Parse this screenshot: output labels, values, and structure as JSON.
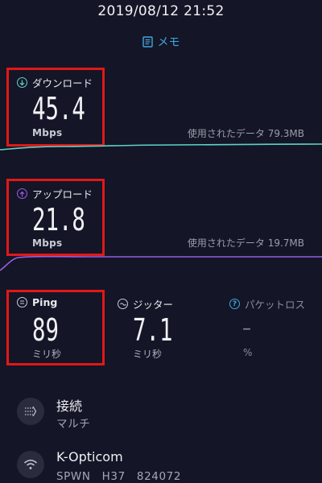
{
  "status": {
    "datetime": "2019/08/12 21:52"
  },
  "memo": {
    "label": "メモ"
  },
  "download": {
    "label": "ダウンロード",
    "value": "45.4",
    "unit": "Mbps",
    "used": "使用されたデータ 79.3MB"
  },
  "upload": {
    "label": "アップロード",
    "value": "21.8",
    "unit": "Mbps",
    "used": "使用されたデータ 19.7MB"
  },
  "ping": {
    "label": "Ping",
    "value": "89",
    "unit": "ミリ秒"
  },
  "jitter": {
    "label": "ジッター",
    "value": "7.1",
    "unit": "ミリ秒"
  },
  "packet_loss": {
    "label": "パケットロス",
    "value": "–",
    "unit": "%"
  },
  "connection": {
    "title": "接続",
    "value": "マルチ"
  },
  "provider": {
    "title": "K-Opticom",
    "server": "SPWN　H37　824072"
  },
  "colors": {
    "download": "#5fd2c8",
    "upload": "#9a5de0",
    "memo": "#3fa6df",
    "highlight": "#e01818"
  },
  "icons": {
    "download": "download-arrow-icon",
    "upload": "upload-arrow-icon",
    "ping": "ping-icon",
    "jitter": "jitter-wave-icon",
    "packet_loss": "question-mark-icon",
    "connection": "multi-connection-icon",
    "provider": "wifi-icon"
  }
}
